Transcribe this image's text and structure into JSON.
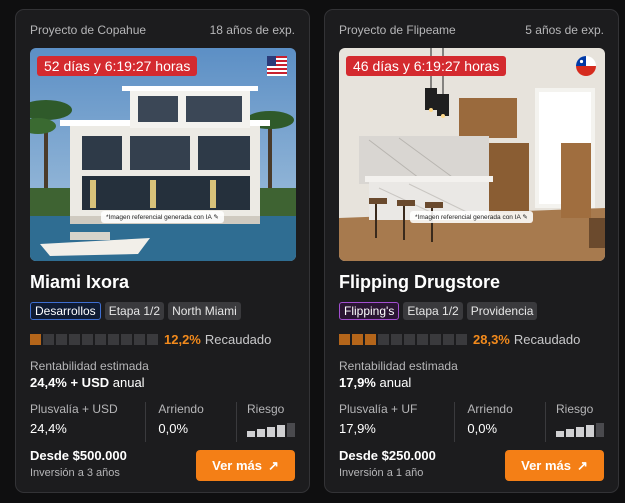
{
  "cards": [
    {
      "developer": "Proyecto de Copahue",
      "experience": "18 años de exp.",
      "countdown": "52 días y 6:19:27 horas",
      "flag_icon": "us-flag-icon",
      "ai_note": "*Imagen referencial generada con IA ✎",
      "title": "Miami Ixora",
      "tags": [
        "Desarrollos",
        "Etapa 1/2",
        "North Miami"
      ],
      "progress_fraction": 0.122,
      "funded_pct": "12,2%",
      "funded_label": "Recaudado",
      "yield_label": "Rentabilidad estimada",
      "yield_value": "24,4% + USD",
      "yield_suffix": "anual",
      "plusvalia_label": "Plusvalía + USD",
      "plusvalia_value": "24,4%",
      "arriendo_label": "Arriendo",
      "arriendo_value": "0,0%",
      "riesgo_label": "Riesgo",
      "risk_level": 4,
      "risk_max": 5,
      "price": "Desde $500.000",
      "horizon": "Inversión a 3 años",
      "cta": "Ver más"
    },
    {
      "developer": "Proyecto de Flipeame",
      "experience": "5 años de exp.",
      "countdown": "46 días y 6:19:27 horas",
      "flag_icon": "chile-flag-icon",
      "ai_note": "*Imagen referencial generada con IA ✎",
      "title": "Flipping Drugstore",
      "tags": [
        "Flipping's",
        "Etapa 1/2",
        "Providencia"
      ],
      "progress_fraction": 0.283,
      "funded_pct": "28,3%",
      "funded_label": "Recaudado",
      "yield_label": "Rentabilidad estimada",
      "yield_value": "17,9%",
      "yield_suffix": "anual",
      "plusvalia_label": "Plusvalía + UF",
      "plusvalia_value": "17,9%",
      "arriendo_label": "Arriendo",
      "arriendo_value": "0,0%",
      "riesgo_label": "Riesgo",
      "risk_level": 4,
      "risk_max": 5,
      "price": "Desde $250.000",
      "horizon": "Inversión a 1 año",
      "cta": "Ver más"
    }
  ],
  "colors": {
    "accent": "#f47f16",
    "progress_filled": "#b4651a",
    "progress_empty": "#3a3a3d",
    "timer_bg": "#d42a2f",
    "tag_blue_border": "#3f6fd1",
    "tag_purple_border": "#a34fd1"
  }
}
